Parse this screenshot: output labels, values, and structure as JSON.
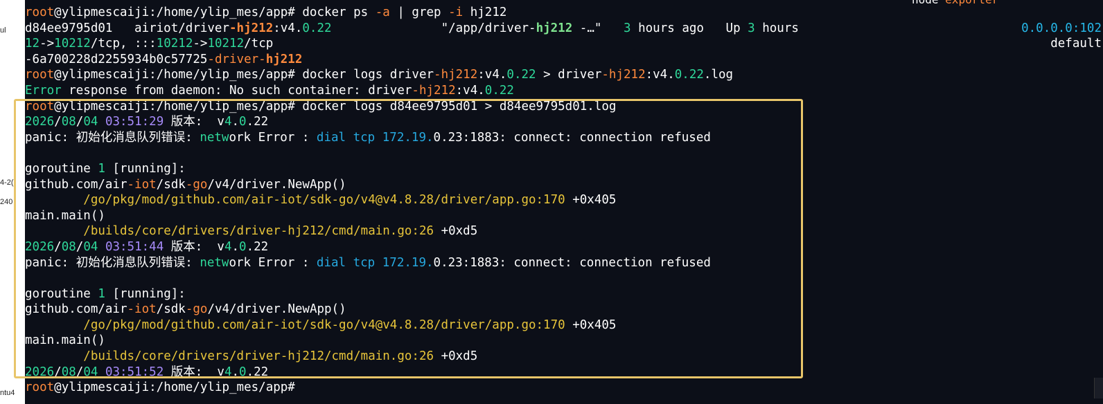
{
  "side_labels": [
    "ul",
    "4-2(",
    "240",
    "ntu4"
  ],
  "background_label": {
    "a": "node",
    "b": "exporter"
  },
  "colors": {
    "terminal_bg": "#0c0f18",
    "prompt": "#ff8a3d",
    "highlight_border": "#e8c56a"
  },
  "lines": [
    {
      "segments": [
        [
          "root",
          "orange"
        ],
        [
          "@ylipmescaiji:/home/ylip_mes/app# docker ps ",
          ""
        ],
        [
          "-a",
          "orange"
        ],
        [
          " | grep ",
          ""
        ],
        [
          "-i",
          "orange"
        ],
        [
          " hj212",
          ""
        ]
      ]
    },
    {
      "segments": [
        [
          "d84ee9795d01   airiot/driver",
          ""
        ],
        [
          "-hj212",
          "orangeb"
        ],
        [
          ":v4.",
          ""
        ],
        [
          "0.22",
          "green"
        ],
        [
          "               \"/app/driver-",
          ""
        ],
        [
          "hj212",
          "greenb"
        ],
        [
          " -…\"   ",
          ""
        ],
        [
          "3",
          "green"
        ],
        [
          " hours ago   Up ",
          ""
        ],
        [
          "3",
          "green"
        ],
        [
          " hours",
          ""
        ]
      ],
      "right": [
        [
          "0.0.0.0:102",
          "cyan"
        ]
      ]
    },
    {
      "segments": [
        [
          "12",
          "green"
        ],
        [
          "->",
          ""
        ],
        [
          "10212",
          "green"
        ],
        [
          "/tcp, :::",
          ""
        ],
        [
          "10212",
          "green"
        ],
        [
          "->",
          ""
        ],
        [
          "10212",
          "green"
        ],
        [
          "/tcp",
          ""
        ]
      ],
      "right": [
        [
          "default",
          ""
        ]
      ]
    },
    {
      "segments": [
        [
          "-6a700228d2255934b0c57725",
          ""
        ],
        [
          "-driver-",
          "orange"
        ],
        [
          "hj212",
          "orangeb"
        ]
      ]
    },
    {
      "segments": [
        [
          "root",
          "orange"
        ],
        [
          "@ylipmescaiji:/home/ylip_mes/app# docker logs driver",
          ""
        ],
        [
          "-hj212",
          "orange"
        ],
        [
          ":v4.",
          ""
        ],
        [
          "0.22",
          "green"
        ],
        [
          " > driver",
          ""
        ],
        [
          "-hj212",
          "orange"
        ],
        [
          ":v4.",
          ""
        ],
        [
          "0.22",
          "green"
        ],
        [
          ".log",
          ""
        ]
      ]
    },
    {
      "segments": [
        [
          "Error",
          "green"
        ],
        [
          " response from daemon: No such container: driver",
          ""
        ],
        [
          "-hj212",
          "orange"
        ],
        [
          ":v4.",
          ""
        ],
        [
          "0.22",
          "green"
        ]
      ]
    },
    {
      "segments": [
        [
          "root",
          "orange"
        ],
        [
          "@ylipmescaiji:/home/ylip_mes/app# docker logs d84ee9795d01 > d84ee9795d01.log",
          ""
        ]
      ]
    },
    {
      "segments": [
        [
          "2026",
          "green"
        ],
        [
          "/",
          ""
        ],
        [
          "08",
          "green"
        ],
        [
          "/",
          ""
        ],
        [
          "04",
          "green"
        ],
        [
          " ",
          ""
        ],
        [
          "03:51:29",
          "purple"
        ],
        [
          " 版本:  v",
          ""
        ],
        [
          "4",
          "green"
        ],
        [
          ".",
          ""
        ],
        [
          "0",
          "green"
        ],
        [
          ".22",
          ""
        ]
      ]
    },
    {
      "segments": [
        [
          "panic: 初始化消息队列错误: ",
          ""
        ],
        [
          "netw",
          "green"
        ],
        [
          "ork Error : ",
          ""
        ],
        [
          "dial tcp",
          "blue"
        ],
        [
          " ",
          ""
        ],
        [
          "172.19.",
          "blue"
        ],
        [
          "0.23:1883: connect: connection refused",
          ""
        ]
      ]
    },
    {
      "segments": [
        [
          "",
          ""
        ]
      ]
    },
    {
      "segments": [
        [
          "goroutine ",
          ""
        ],
        [
          "1",
          "green"
        ],
        [
          " [running]:",
          ""
        ]
      ]
    },
    {
      "segments": [
        [
          "github.com/air",
          ""
        ],
        [
          "-iot",
          "orange"
        ],
        [
          "/sdk",
          ""
        ],
        [
          "-go",
          "orange"
        ],
        [
          "/v4/driver.NewApp()",
          ""
        ]
      ]
    },
    {
      "segments": [
        [
          "        ",
          ""
        ],
        [
          "/go/pkg/mod/github.com/air-iot/sdk-go/v4@v4.8.28/driver/app.go:170",
          "yellow"
        ],
        [
          " +0x405",
          ""
        ]
      ]
    },
    {
      "segments": [
        [
          "main.main()",
          ""
        ]
      ]
    },
    {
      "segments": [
        [
          "        ",
          ""
        ],
        [
          "/builds/core/drivers/driver-hj212/cmd/main.go:26",
          "yellow"
        ],
        [
          " +0xd5",
          ""
        ]
      ]
    },
    {
      "segments": [
        [
          "2026",
          "green"
        ],
        [
          "/",
          ""
        ],
        [
          "08",
          "green"
        ],
        [
          "/",
          ""
        ],
        [
          "04",
          "green"
        ],
        [
          " ",
          ""
        ],
        [
          "03:51:44",
          "purple"
        ],
        [
          " 版本:  v",
          ""
        ],
        [
          "4",
          "green"
        ],
        [
          ".",
          ""
        ],
        [
          "0",
          "green"
        ],
        [
          ".22",
          ""
        ]
      ]
    },
    {
      "segments": [
        [
          "panic: 初始化消息队列错误: ",
          ""
        ],
        [
          "netw",
          "green"
        ],
        [
          "ork Error : ",
          ""
        ],
        [
          "dial tcp",
          "blue"
        ],
        [
          " ",
          ""
        ],
        [
          "172.19.",
          "blue"
        ],
        [
          "0.23:1883: connect: connection refused",
          ""
        ]
      ]
    },
    {
      "segments": [
        [
          "",
          ""
        ]
      ]
    },
    {
      "segments": [
        [
          "goroutine ",
          ""
        ],
        [
          "1",
          "green"
        ],
        [
          " [running]:",
          ""
        ]
      ]
    },
    {
      "segments": [
        [
          "github.com/air",
          ""
        ],
        [
          "-iot",
          "orange"
        ],
        [
          "/sdk",
          ""
        ],
        [
          "-go",
          "orange"
        ],
        [
          "/v4/driver.NewApp()",
          ""
        ]
      ]
    },
    {
      "segments": [
        [
          "        ",
          ""
        ],
        [
          "/go/pkg/mod/github.com/air-iot/sdk-go/v4@v4.8.28/driver/app.go:170",
          "yellow"
        ],
        [
          " +0x405",
          ""
        ]
      ]
    },
    {
      "segments": [
        [
          "main.main()",
          ""
        ]
      ]
    },
    {
      "segments": [
        [
          "        ",
          ""
        ],
        [
          "/builds/core/drivers/driver-hj212/cmd/main.go:26",
          "yellow"
        ],
        [
          " +0xd5",
          ""
        ]
      ]
    },
    {
      "segments": [
        [
          "2026",
          "green"
        ],
        [
          "/",
          ""
        ],
        [
          "08",
          "green"
        ],
        [
          "/",
          ""
        ],
        [
          "04",
          "green"
        ],
        [
          " ",
          ""
        ],
        [
          "03:51:52",
          "purple"
        ],
        [
          " 版本:  v",
          ""
        ],
        [
          "4",
          "green"
        ],
        [
          ".",
          ""
        ],
        [
          "0",
          "green"
        ],
        [
          ".22",
          ""
        ]
      ]
    },
    {
      "segments": [
        [
          "root",
          "orange"
        ],
        [
          "@ylipmescaiji:/home/ylip_mes/app# ",
          ""
        ]
      ]
    }
  ]
}
